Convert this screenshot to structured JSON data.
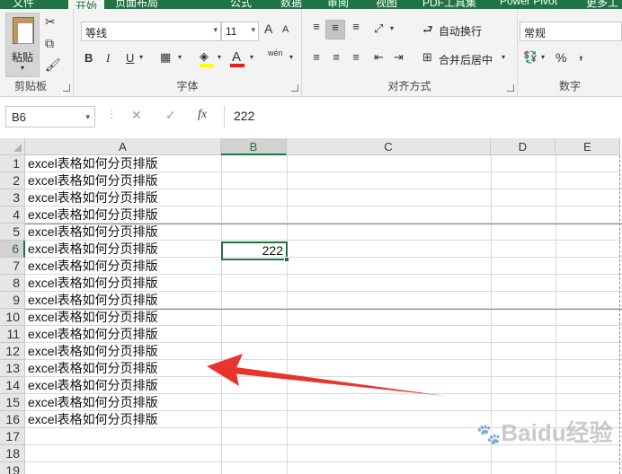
{
  "ribbon_tabs": [
    "文件",
    "开始",
    "页面布局",
    "公式",
    "数据",
    "审阅",
    "视图",
    "PDF工具集",
    "Power Pivot",
    "更多工"
  ],
  "clipboard": {
    "paste_label": "粘贴",
    "group_label": "剪贴板"
  },
  "font": {
    "name": "等线",
    "size": "11",
    "grow_label": "A",
    "shrink_label": "A",
    "bold": "B",
    "italic": "I",
    "underline": "U",
    "pinyin_label": "wén",
    "group_label": "字体",
    "fill_color": "#ffff00",
    "font_color": "#e0201b"
  },
  "alignment": {
    "wrap_text": "自动换行",
    "merge_center": "合并后居中",
    "group_label": "对齐方式"
  },
  "number": {
    "format": "常规",
    "percent": "%",
    "comma": ",",
    "group_label": "数字"
  },
  "formula_bar": {
    "name_box": "B6",
    "fx_label": "fx",
    "value": "222"
  },
  "columns": [
    "A",
    "B",
    "C",
    "D",
    "E"
  ],
  "active_column": "B",
  "rows": [
    "1",
    "2",
    "3",
    "4",
    "5",
    "6",
    "7",
    "8",
    "9",
    "10",
    "11",
    "12",
    "13",
    "14",
    "15",
    "16",
    "17",
    "18",
    "19"
  ],
  "active_row": "6",
  "cells_a": [
    "excel表格如何分页排版",
    "excel表格如何分页排版",
    "excel表格如何分页排版",
    "excel表格如何分页排版",
    "excel表格如何分页排版",
    "excel表格如何分页排版",
    "excel表格如何分页排版",
    "excel表格如何分页排版",
    "excel表格如何分页排版",
    "excel表格如何分页排版",
    "excel表格如何分页排版",
    "excel表格如何分页排版",
    "excel表格如何分页排版",
    "excel表格如何分页排版",
    "excel表格如何分页排版",
    "excel表格如何分页排版"
  ],
  "selected_cell": {
    "ref": "B6",
    "value": "222"
  },
  "annotation_arrow_color": "#e8342c",
  "watermark": "Baidu经验"
}
